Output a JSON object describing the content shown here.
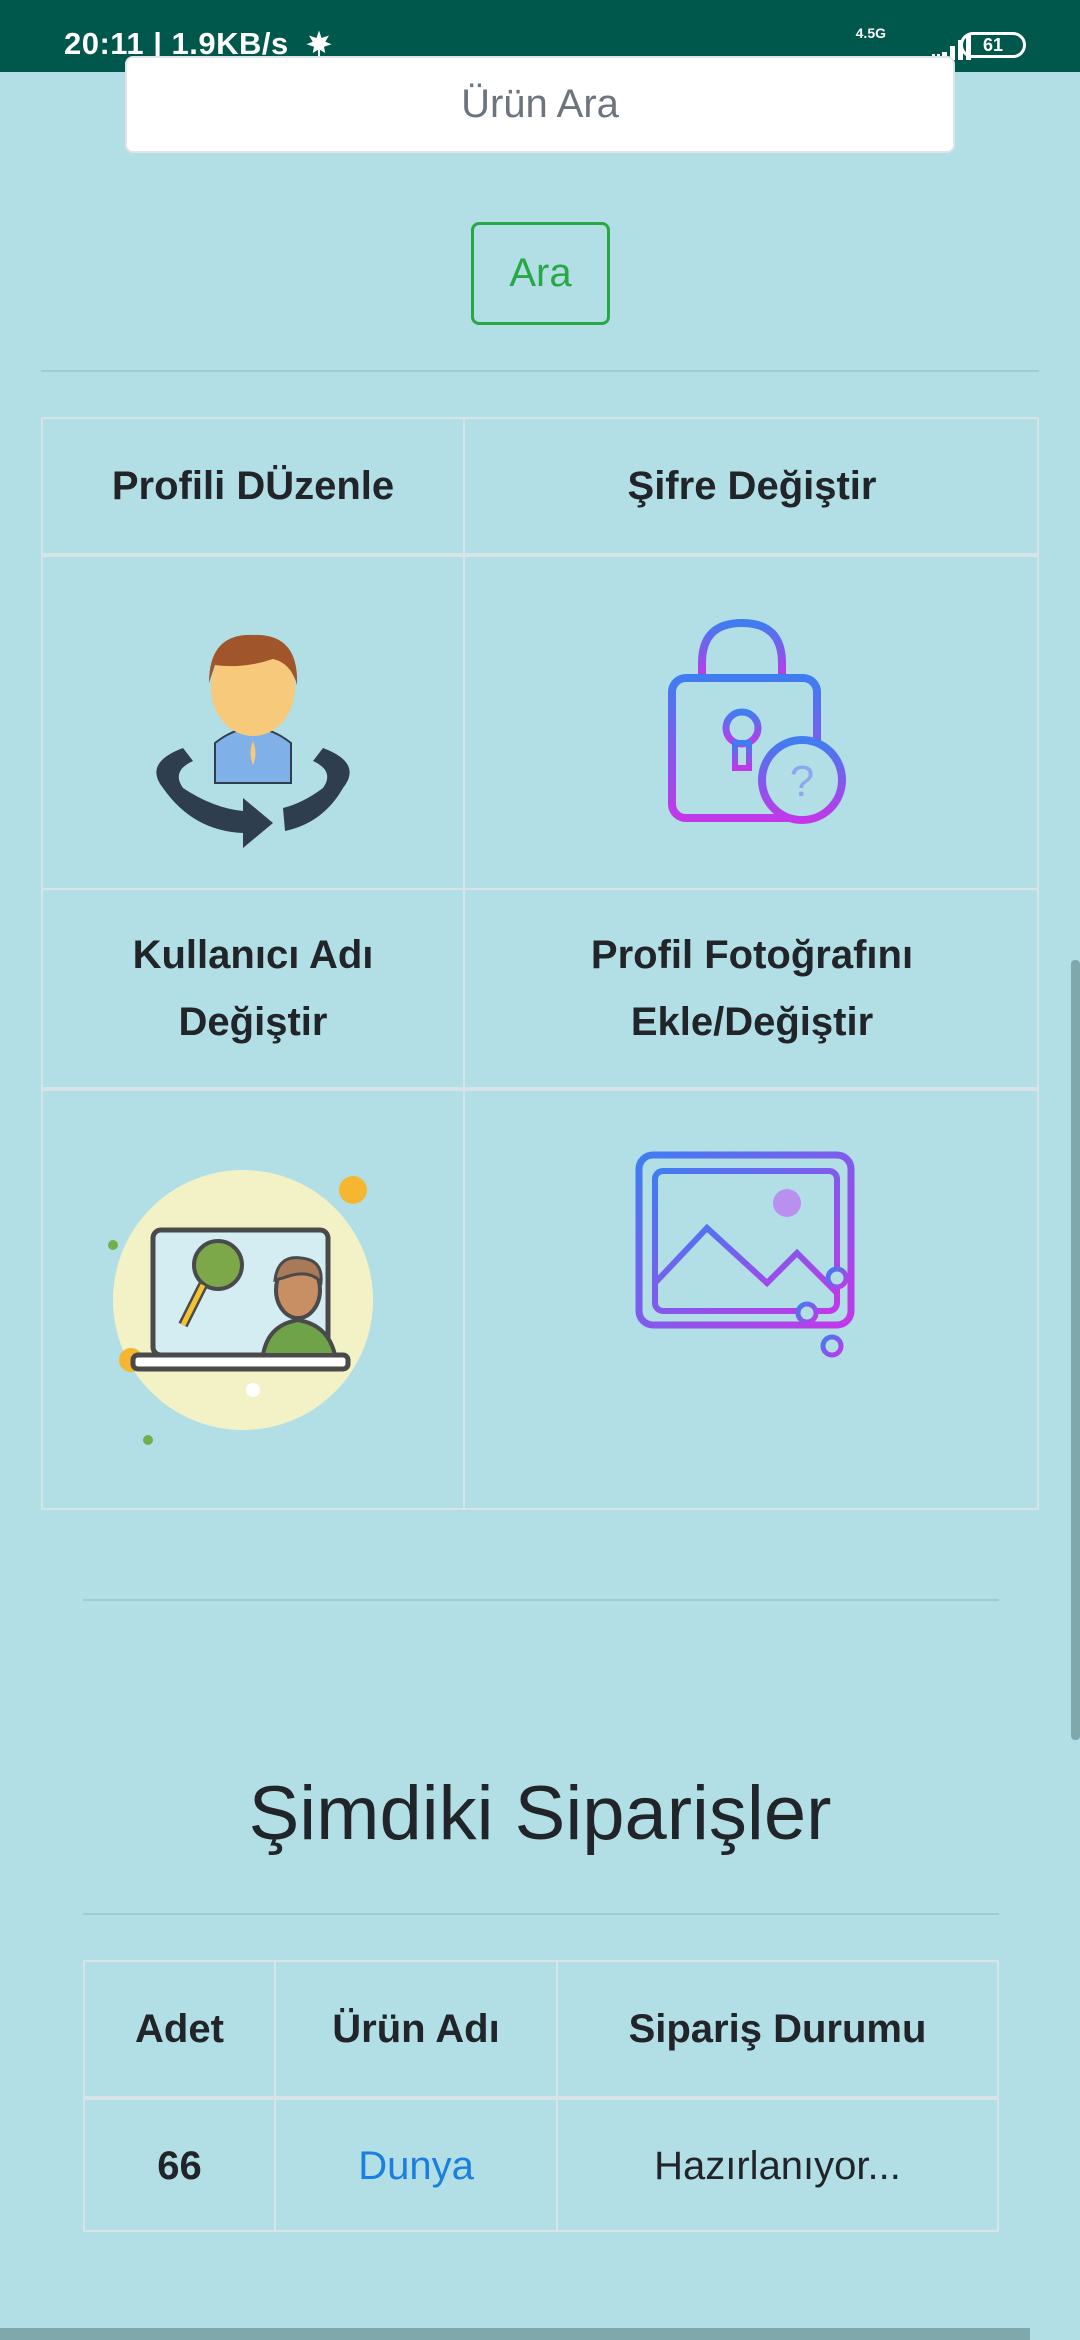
{
  "status_bar": {
    "time_speed": "20:11 | 1.9KB/s",
    "network": "4.5G",
    "battery": "61"
  },
  "search": {
    "placeholder": "Ürün Ara",
    "button_label": "Ara"
  },
  "profile_menu": {
    "edit_profile": "Profili DÜzenle",
    "change_password": "Şifre Değiştir",
    "change_username_line1": "Kullanıcı Adı",
    "change_username_line2": "Değiştir",
    "photo_line1": "Profil Fotoğrafını",
    "photo_line2": "Ekle/Değiştir",
    "icons": [
      "user-rotate-icon",
      "lock-question-icon",
      "video-call-icon",
      "image-settings-icon"
    ]
  },
  "orders": {
    "title": "Şimdiki Siparişler",
    "headers": [
      "Adet",
      "Ürün Adı",
      "Sipariş Durumu"
    ],
    "rows": [
      {
        "quantity": "66",
        "product": "Dunya",
        "status": "Hazırlanıyor..."
      }
    ]
  },
  "colors": {
    "background": "#b2dfe5",
    "status_bar": "#00574b",
    "accent_green": "#28a745",
    "link_blue": "#1a7fe0"
  }
}
